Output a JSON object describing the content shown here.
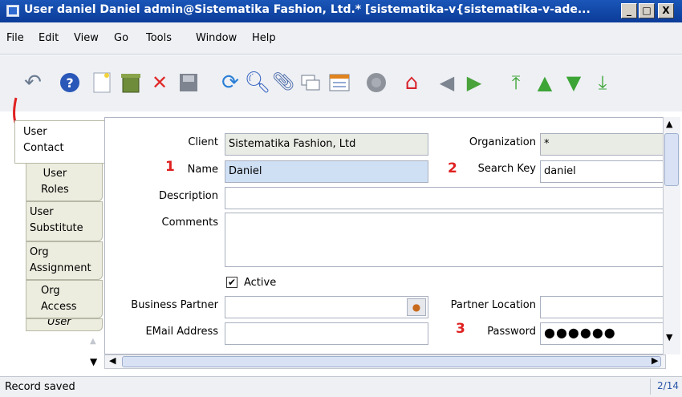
{
  "window": {
    "title": "User  daniel  Daniel  admin@Sistematika Fashion, Ltd.* [sistematika-v{sistematika-v-ade...",
    "min": "_",
    "max": "□",
    "close": "X"
  },
  "menu": [
    "File",
    "Edit",
    "View",
    "Go",
    "Tools",
    "Window",
    "Help"
  ],
  "toolbar_icons": [
    "undo-icon",
    "help-icon",
    "new-record-icon",
    "delete-icon",
    "delete-selection-icon",
    "save-icon",
    "refresh-icon",
    "find-icon",
    "attachment-icon",
    "chat-icon",
    "report-icon",
    "archive-icon",
    "home-icon",
    "back-icon",
    "forward-icon",
    "first-record-icon",
    "previous-record-icon",
    "next-record-icon",
    "last-record-icon"
  ],
  "tabs": [
    {
      "label": "User\nContact"
    },
    {
      "label": "User\nRoles"
    },
    {
      "label": "User\nSubstitute"
    },
    {
      "label": "Org\nAssignment"
    },
    {
      "label": "Org\nAccess"
    },
    {
      "label": "User"
    }
  ],
  "form": {
    "client_label": "Client",
    "client_value": "Sistematika Fashion, Ltd",
    "org_label": "Organization",
    "org_value": "*",
    "name_label": "Name",
    "name_value": "Daniel",
    "search_key_label": "Search Key",
    "search_key_value": "daniel",
    "description_label": "Description",
    "description_value": "",
    "comments_label": "Comments",
    "comments_value": "",
    "active_label": "Active",
    "active_checked": true,
    "bp_label": "Business Partner",
    "bp_value": "",
    "partner_location_label": "Partner Location",
    "partner_location_value": "",
    "email_label": "EMail Address",
    "email_value": "",
    "password_label": "Password",
    "password_value": "●●●●●●"
  },
  "annotations": {
    "n1": "1",
    "n2": "2",
    "n3": "3"
  },
  "status": {
    "text": "Record saved",
    "record": "2/14"
  }
}
